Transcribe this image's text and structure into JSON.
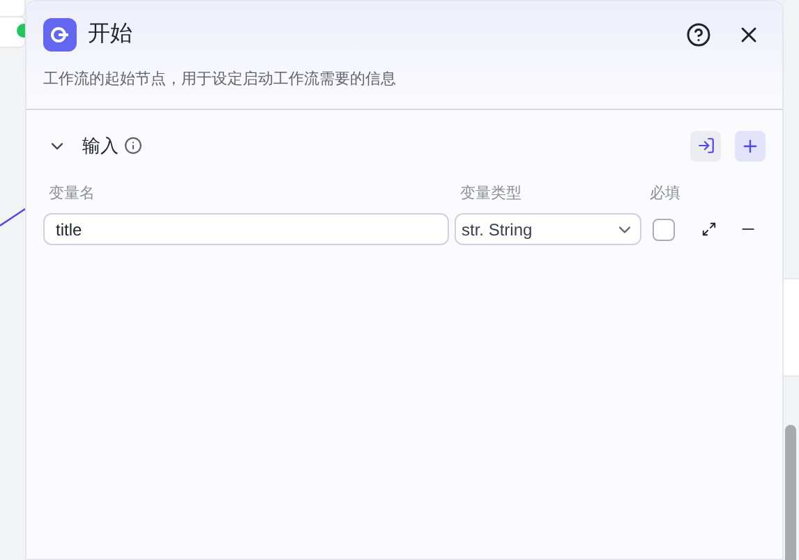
{
  "panel": {
    "title": "开始",
    "description": "工作流的起始节点，用于设定启动工作流需要的信息"
  },
  "section": {
    "title": "输入",
    "expanded": true
  },
  "columns": [
    "变量名",
    "变量类型",
    "必填"
  ],
  "variables": [
    {
      "name": "title",
      "type": "str. String",
      "required": false
    }
  ]
}
